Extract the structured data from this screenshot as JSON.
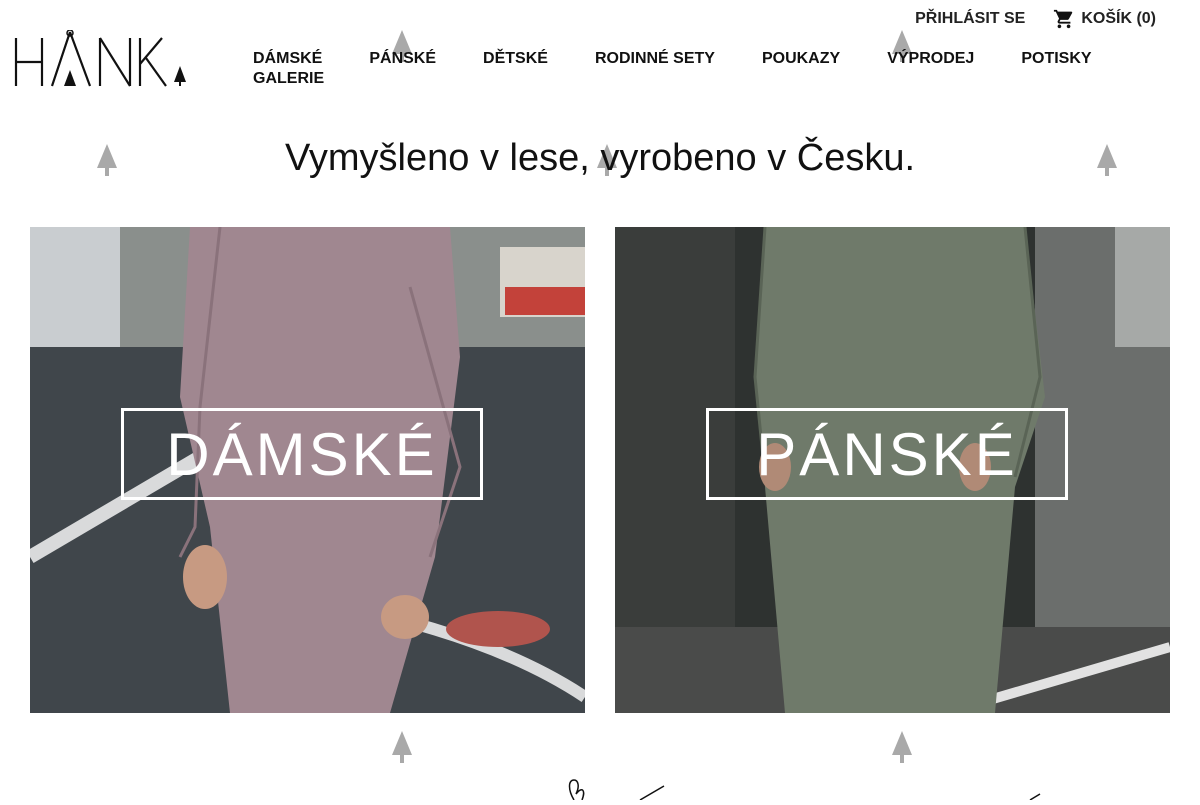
{
  "brand": {
    "logo_text": "HÅNK"
  },
  "topbar": {
    "login_label": "PŘIHLÁSIT SE",
    "cart_label": "KOŠÍK (0)",
    "cart_icon": "cart-icon"
  },
  "nav": {
    "items": [
      {
        "label": "DÁMSKÉ"
      },
      {
        "label": "PÁNSKÉ"
      },
      {
        "label": "DĚTSKÉ"
      },
      {
        "label": "RODINNÉ SETY"
      },
      {
        "label": "POUKAZY"
      },
      {
        "label": "VÝPRODEJ"
      },
      {
        "label": "POTISKY"
      },
      {
        "label": "GALERIE"
      }
    ]
  },
  "headline": "Vymyšleno v lese, vyrobeno v Česku.",
  "categories": [
    {
      "label": "DÁMSKÉ",
      "accent": "#a08790"
    },
    {
      "label": "PÁNSKÉ",
      "accent": "#6f7a6a"
    }
  ]
}
